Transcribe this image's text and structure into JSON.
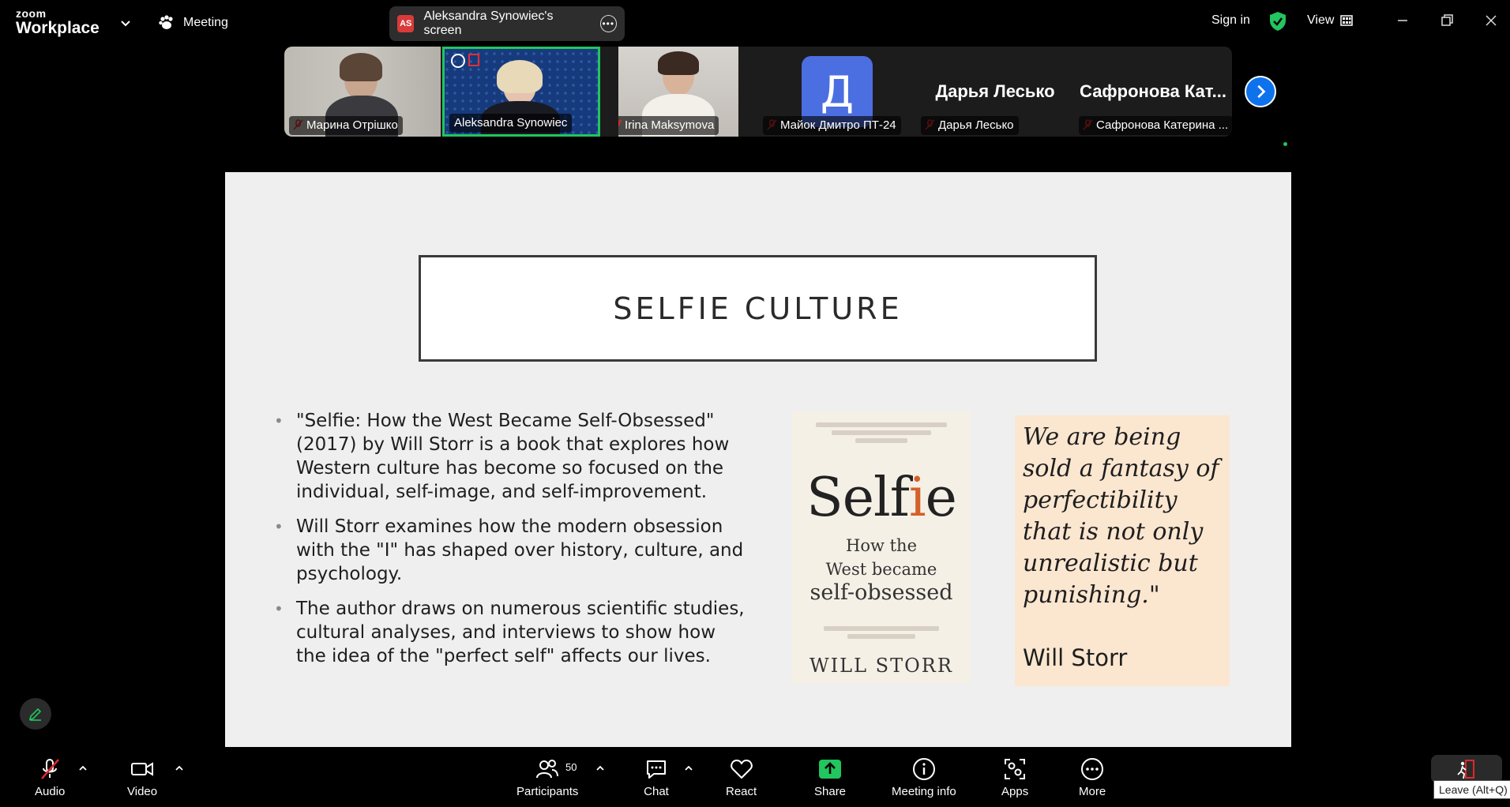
{
  "app": {
    "logo_small": "zoom",
    "logo_big": "Workplace"
  },
  "header": {
    "meeting_label": "Meeting",
    "screen_share": {
      "initials": "AS",
      "label": "Aleksandra Synowiec's screen"
    },
    "sign_in": "Sign in",
    "view": "View"
  },
  "participants": [
    {
      "name": "Марина Отрішко"
    },
    {
      "name": "Aleksandra Synowiec"
    },
    {
      "name": "Irina Maksymova"
    },
    {
      "name": "Майок Дмитро ПТ-24",
      "avatar_letter": "Д"
    },
    {
      "name": "Дарья Лесько",
      "display_name": "Дарья Лесько"
    },
    {
      "name": "Сафронова Катерина ...",
      "display_name": "Сафронова Кат..."
    }
  ],
  "slide": {
    "title": "SELFIE CULTURE",
    "bullets": [
      "\"Selfie: How the West Became Self-Obsessed\" (2017) by Will Storr is a book that explores how Western culture has become so focused on the individual, self-image, and self-improvement.",
      "Will Storr examines how the modern obsession with the \"I\" has shaped over history, culture, and psychology.",
      "The author draws on numerous scientific studies, cultural analyses, and interviews to show how the idea of the \"perfect self\" affects our lives."
    ],
    "book": {
      "title_pre": "Self",
      "title_i": "i",
      "title_post": "e",
      "subtitle_1": "How the",
      "subtitle_2": "West became",
      "subtitle_3": "self-obsessed",
      "author": "WILL STORR"
    },
    "quote": {
      "text": "We are being sold a fantasy of perfectibility that is not only unrealistic but punishing.\"",
      "author": "Will Storr"
    }
  },
  "toolbar": {
    "audio": "Audio",
    "video": "Video",
    "participants": "Participants",
    "participants_count": "50",
    "chat": "Chat",
    "react": "React",
    "share": "Share",
    "meeting_info": "Meeting info",
    "apps": "Apps",
    "more": "More",
    "leave_tooltip": "Leave (Alt+Q)"
  },
  "colors": {
    "accent_blue": "#0e72ed",
    "share_green": "#22c55e",
    "muted_red": "#e02828"
  }
}
